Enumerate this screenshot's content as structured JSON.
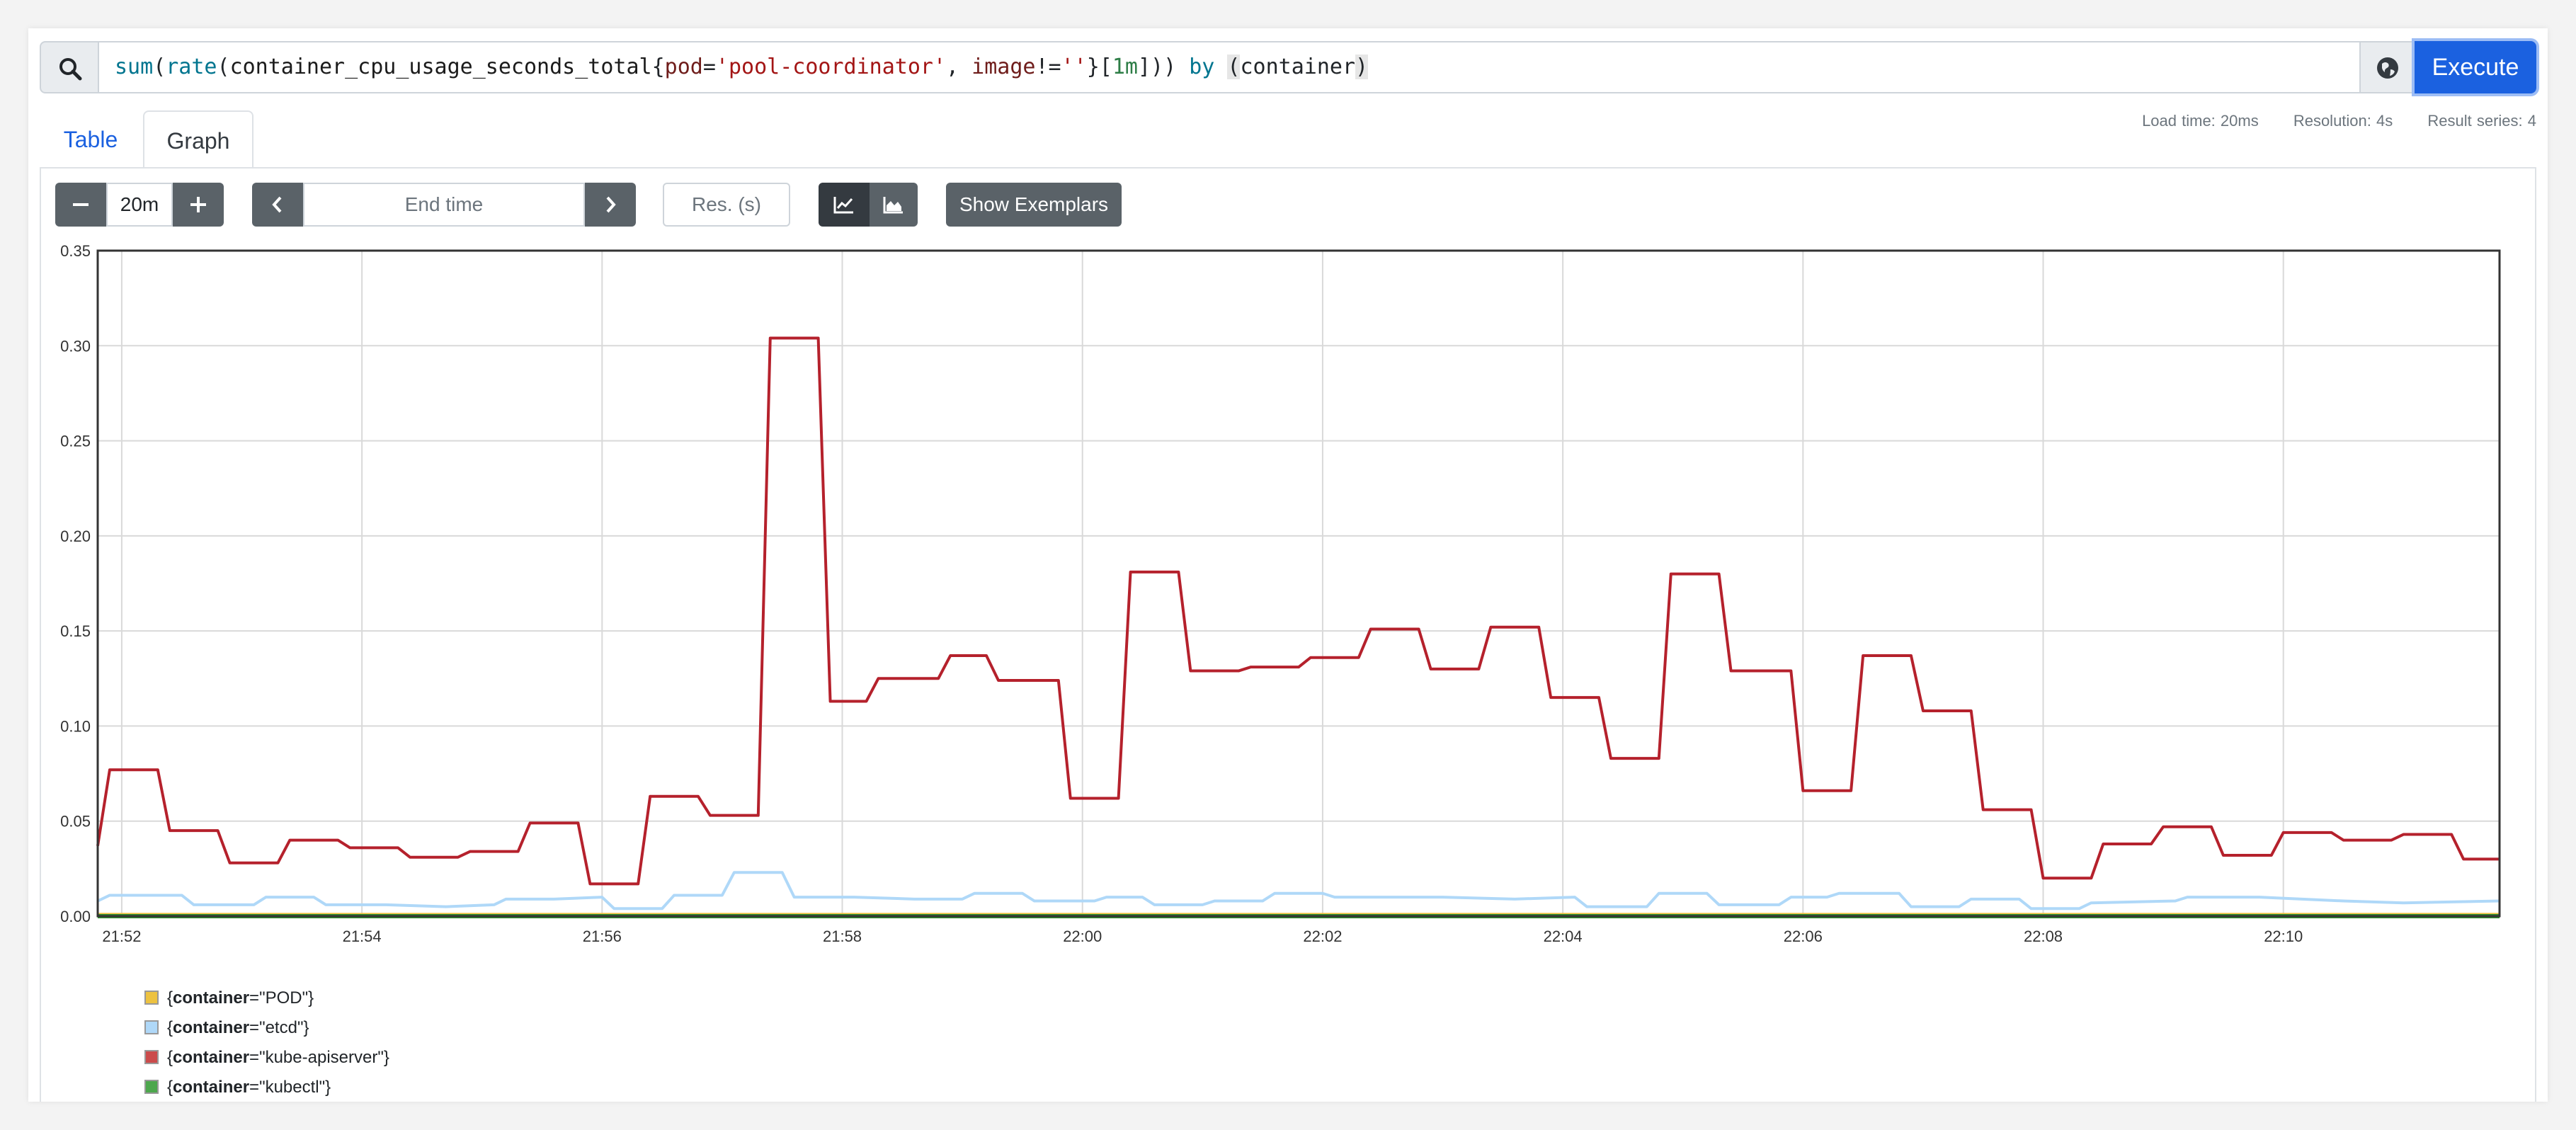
{
  "query": {
    "tokens": [
      {
        "t": "sum",
        "c": "t-fn"
      },
      {
        "t": "(",
        "c": ""
      },
      {
        "t": "rate",
        "c": "t-fn"
      },
      {
        "t": "(",
        "c": ""
      },
      {
        "t": "container_cpu_usage_seconds_total",
        "c": "t-metric"
      },
      {
        "t": "{",
        "c": ""
      },
      {
        "t": "pod",
        "c": "t-label"
      },
      {
        "t": "=",
        "c": ""
      },
      {
        "t": "'pool-coordinator'",
        "c": "t-str"
      },
      {
        "t": ", ",
        "c": ""
      },
      {
        "t": "image",
        "c": "t-label"
      },
      {
        "t": "!=",
        "c": ""
      },
      {
        "t": "''",
        "c": "t-str"
      },
      {
        "t": "}[",
        "c": ""
      },
      {
        "t": "1m",
        "c": "t-dur"
      },
      {
        "t": "])) ",
        "c": ""
      },
      {
        "t": "by",
        "c": "t-kw"
      },
      {
        "t": " ",
        "c": ""
      },
      {
        "t": "(",
        "c": "t-match"
      },
      {
        "t": "container",
        "c": ""
      },
      {
        "t": ")",
        "c": "t-match"
      }
    ],
    "execute_label": "Execute"
  },
  "tabs": {
    "table": "Table",
    "graph": "Graph"
  },
  "stats": {
    "load_time": "Load time: 20ms",
    "resolution": "Resolution: 4s",
    "result_series": "Result series: 4"
  },
  "controls": {
    "range": "20m",
    "end_time_placeholder": "End time",
    "res_placeholder": "Res. (s)",
    "show_exemplars": "Show Exemplars"
  },
  "legend": [
    {
      "key": "container",
      "value": "\"POD\"",
      "color": "#edc240"
    },
    {
      "key": "container",
      "value": "\"etcd\"",
      "color": "#afd8f8"
    },
    {
      "key": "container",
      "value": "\"kube-apiserver\"",
      "color": "#cb4b4b"
    },
    {
      "key": "container",
      "value": "\"kubectl\"",
      "color": "#4da74d"
    }
  ],
  "chart_data": {
    "type": "line",
    "x_unit": "minutes (time of day 21:51.8 - 22:11.8)",
    "xlim": [
      "21:51.8",
      "22:11.8"
    ],
    "ylim": [
      0,
      0.35
    ],
    "y_ticks": [
      "0.00",
      "0.05",
      "0.10",
      "0.15",
      "0.20",
      "0.25",
      "0.30",
      "0.35"
    ],
    "x_ticks": [
      "21:52",
      "21:54",
      "21:56",
      "21:58",
      "22:00",
      "22:02",
      "22:04",
      "22:06",
      "22:08",
      "22:10"
    ],
    "grid": true,
    "series": [
      {
        "name": "{container=\"POD\"}",
        "color": "#edc240",
        "points": [
          [
            "21:51.8",
            0.001
          ],
          [
            "22:11.8",
            0.001
          ]
        ]
      },
      {
        "name": "{container=\"etcd\"}",
        "color": "#afd8f8",
        "points": [
          [
            "21:51.8",
            0.008
          ],
          [
            "21:51.9",
            0.011
          ],
          [
            "21:52.3",
            0.011
          ],
          [
            "21:52.5",
            0.011
          ],
          [
            "21:52.6",
            0.006
          ],
          [
            "21:53.1",
            0.006
          ],
          [
            "21:53.2",
            0.01
          ],
          [
            "21:53.6",
            0.01
          ],
          [
            "21:53.7",
            0.006
          ],
          [
            "21:54.2",
            0.006
          ],
          [
            "21:54.7",
            0.005
          ],
          [
            "21:55.1",
            0.006
          ],
          [
            "21:55.2",
            0.009
          ],
          [
            "21:55.6",
            0.009
          ],
          [
            "21:56.0",
            0.01
          ],
          [
            "21:56.1",
            0.004
          ],
          [
            "21:56.5",
            0.004
          ],
          [
            "21:56.6",
            0.011
          ],
          [
            "21:57.0",
            0.011
          ],
          [
            "21:57.1",
            0.023
          ],
          [
            "21:57.5",
            0.023
          ],
          [
            "21:57.6",
            0.01
          ],
          [
            "21:58.1",
            0.01
          ],
          [
            "21:58.6",
            0.009
          ],
          [
            "21:59.0",
            0.009
          ],
          [
            "21:59.1",
            0.012
          ],
          [
            "21:59.5",
            0.012
          ],
          [
            "21:59.6",
            0.008
          ],
          [
            "22:00.1",
            0.008
          ],
          [
            "22:00.2",
            0.01
          ],
          [
            "22:00.5",
            0.01
          ],
          [
            "22:00.6",
            0.006
          ],
          [
            "22:01.0",
            0.006
          ],
          [
            "22:01.1",
            0.008
          ],
          [
            "22:01.5",
            0.008
          ],
          [
            "22:01.6",
            0.012
          ],
          [
            "22:02.0",
            0.012
          ],
          [
            "22:02.1",
            0.01
          ],
          [
            "22:03.0",
            0.01
          ],
          [
            "22:03.6",
            0.009
          ],
          [
            "22:04.1",
            0.01
          ],
          [
            "22:04.2",
            0.005
          ],
          [
            "22:04.7",
            0.005
          ],
          [
            "22:04.8",
            0.012
          ],
          [
            "22:05.2",
            0.012
          ],
          [
            "22:05.3",
            0.006
          ],
          [
            "22:05.8",
            0.006
          ],
          [
            "22:05.9",
            0.01
          ],
          [
            "22:06.2",
            0.01
          ],
          [
            "22:06.3",
            0.012
          ],
          [
            "22:06.8",
            0.012
          ],
          [
            "22:06.9",
            0.005
          ],
          [
            "22:07.3",
            0.005
          ],
          [
            "22:07.4",
            0.009
          ],
          [
            "22:07.8",
            0.009
          ],
          [
            "22:07.9",
            0.004
          ],
          [
            "22:08.3",
            0.004
          ],
          [
            "22:08.4",
            0.007
          ],
          [
            "22:09.1",
            0.008
          ],
          [
            "22:09.2",
            0.01
          ],
          [
            "22:09.8",
            0.01
          ],
          [
            "22:10.5",
            0.008
          ],
          [
            "22:11.0",
            0.007
          ],
          [
            "22:11.8",
            0.008
          ]
        ]
      },
      {
        "name": "{container=\"kube-apiserver\"}",
        "color": "#b5212c",
        "points": [
          [
            "21:51.8",
            0.037
          ],
          [
            "21:51.9",
            0.077
          ],
          [
            "21:52.3",
            0.077
          ],
          [
            "21:52.4",
            0.045
          ],
          [
            "21:52.8",
            0.045
          ],
          [
            "21:52.9",
            0.028
          ],
          [
            "21:53.3",
            0.028
          ],
          [
            "21:53.4",
            0.04
          ],
          [
            "21:53.8",
            0.04
          ],
          [
            "21:53.9",
            0.036
          ],
          [
            "21:54.3",
            0.036
          ],
          [
            "21:54.4",
            0.031
          ],
          [
            "21:54.8",
            0.031
          ],
          [
            "21:54.9",
            0.034
          ],
          [
            "21:55.3",
            0.034
          ],
          [
            "21:55.4",
            0.049
          ],
          [
            "21:55.8",
            0.049
          ],
          [
            "21:55.9",
            0.017
          ],
          [
            "21:56.3",
            0.017
          ],
          [
            "21:56.4",
            0.063
          ],
          [
            "21:56.8",
            0.063
          ],
          [
            "21:56.9",
            0.053
          ],
          [
            "21:57.3",
            0.053
          ],
          [
            "21:57.4",
            0.304
          ],
          [
            "21:57.8",
            0.304
          ],
          [
            "21:57.9",
            0.113
          ],
          [
            "21:58.2",
            0.113
          ],
          [
            "21:58.3",
            0.125
          ],
          [
            "21:58.8",
            0.125
          ],
          [
            "21:58.9",
            0.137
          ],
          [
            "21:59.2",
            0.137
          ],
          [
            "21:59.3",
            0.124
          ],
          [
            "21:59.8",
            0.124
          ],
          [
            "21:59.9",
            0.062
          ],
          [
            "22:00.3",
            0.062
          ],
          [
            "22:00.4",
            0.181
          ],
          [
            "22:00.8",
            0.181
          ],
          [
            "22:00.9",
            0.129
          ],
          [
            "22:01.3",
            0.129
          ],
          [
            "22:01.4",
            0.131
          ],
          [
            "22:01.8",
            0.131
          ],
          [
            "22:01.9",
            0.136
          ],
          [
            "22:02.3",
            0.136
          ],
          [
            "22:02.4",
            0.151
          ],
          [
            "22:02.8",
            0.151
          ],
          [
            "22:02.9",
            0.13
          ],
          [
            "22:03.3",
            0.13
          ],
          [
            "22:03.4",
            0.152
          ],
          [
            "22:03.8",
            0.152
          ],
          [
            "22:03.9",
            0.115
          ],
          [
            "22:04.3",
            0.115
          ],
          [
            "22:04.4",
            0.083
          ],
          [
            "22:04.8",
            0.083
          ],
          [
            "22:04.9",
            0.18
          ],
          [
            "22:05.3",
            0.18
          ],
          [
            "22:05.4",
            0.129
          ],
          [
            "22:05.9",
            0.129
          ],
          [
            "22:06.0",
            0.066
          ],
          [
            "22:06.4",
            0.066
          ],
          [
            "22:06.5",
            0.137
          ],
          [
            "22:06.9",
            0.137
          ],
          [
            "22:07.0",
            0.108
          ],
          [
            "22:07.4",
            0.108
          ],
          [
            "22:07.5",
            0.056
          ],
          [
            "22:07.9",
            0.056
          ],
          [
            "22:08.0",
            0.02
          ],
          [
            "22:08.4",
            0.02
          ],
          [
            "22:08.5",
            0.038
          ],
          [
            "22:08.9",
            0.038
          ],
          [
            "22:09.0",
            0.047
          ],
          [
            "22:09.4",
            0.047
          ],
          [
            "22:09.5",
            0.032
          ],
          [
            "22:09.9",
            0.032
          ],
          [
            "22:10.0",
            0.044
          ],
          [
            "22:10.4",
            0.044
          ],
          [
            "22:10.5",
            0.04
          ],
          [
            "22:10.9",
            0.04
          ],
          [
            "22:11.0",
            0.043
          ],
          [
            "22:11.4",
            0.043
          ],
          [
            "22:11.5",
            0.03
          ],
          [
            "22:11.8",
            0.03
          ]
        ]
      },
      {
        "name": "{container=\"kubectl\"}",
        "color": "#2e8b2e",
        "points": [
          [
            "21:51.8",
            0.0
          ],
          [
            "22:11.8",
            0.0
          ]
        ]
      }
    ]
  }
}
